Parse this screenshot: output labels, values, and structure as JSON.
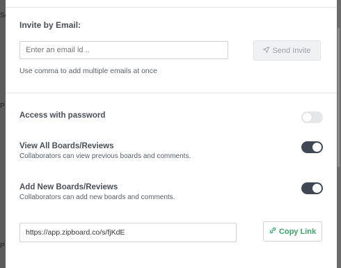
{
  "backdrop": {
    "left_fragment_1": "Sc",
    "left_fragment_2": "P",
    "left_fragment_3": "P"
  },
  "invite": {
    "title": "Invite by Email:",
    "email_placeholder": "Enter an email id ..",
    "send_label": "Send Invite",
    "send_icon": "paper-plane-icon",
    "hint": "Use comma to add multiple emails at once"
  },
  "options": [
    {
      "title": "Access with password",
      "subtitle": "",
      "enabled": false
    },
    {
      "title": "View All Boards/Reviews",
      "subtitle": "Collaborators can view previous boards and comments.",
      "enabled": true
    },
    {
      "title": "Add New Boards/Reviews",
      "subtitle": "Collaborators can add new boards and comments.",
      "enabled": true
    }
  ],
  "share": {
    "link": "https://app.zipboard.co/s/fjKdE",
    "copy_label": "Copy Link",
    "copy_icon": "link-icon"
  },
  "colors": {
    "toggle_on": "#3f4853",
    "toggle_off": "#e6e7e9",
    "copy_accent": "#3aa56a"
  }
}
